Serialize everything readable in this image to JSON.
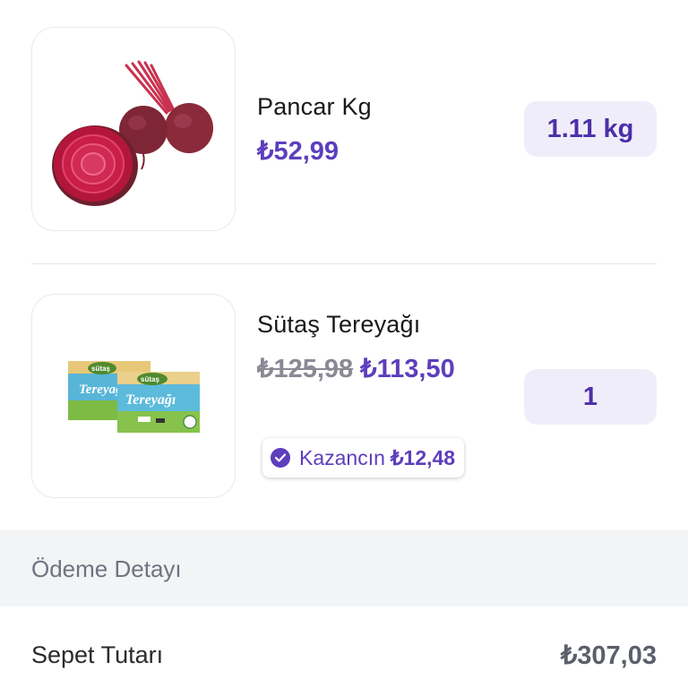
{
  "cart": {
    "items": [
      {
        "name": "Pancar Kg",
        "price": "₺52,99",
        "quantity": "1.11 kg",
        "image_icon": "beetroot-image"
      },
      {
        "name": "Sütaş Tereyağı",
        "old_price": "₺125,98",
        "price": "₺113,50",
        "quantity": "1",
        "savings_label": "Kazancın",
        "savings_amount": "₺12,48",
        "image_icon": "butter-package-image",
        "package_brand": "sütaş",
        "package_label": "Tereyağı"
      }
    ]
  },
  "payment": {
    "section_title": "Ödeme Detayı",
    "basket_total_label": "Sepet Tutarı",
    "basket_total_value": "₺307,03"
  },
  "colors": {
    "brand_purple": "#5d3ebc",
    "qty_background": "#f0edfb",
    "section_background": "#f3f4f6"
  }
}
